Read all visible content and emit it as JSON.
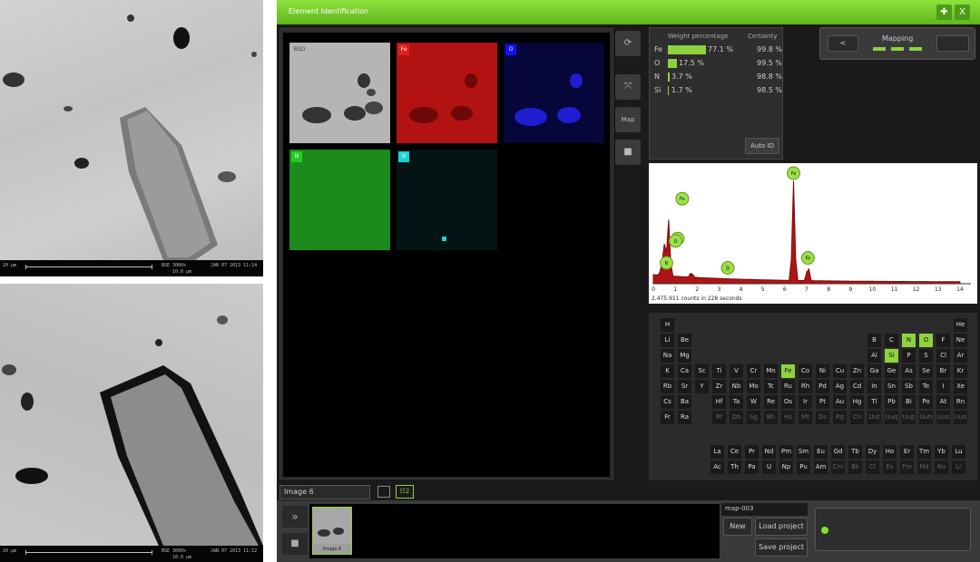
{
  "sem_images": [
    {
      "scale": "20 µm",
      "mag": "3000x",
      "date": "JAN 07 2013 11:14",
      "hfw": "10.0 µm",
      "det": "BSE"
    },
    {
      "scale": "20 µm",
      "mag": "3000x",
      "date": "JAN 07 2013 11:12",
      "hfw": "10.0 µm",
      "det": "BSE"
    }
  ],
  "window": {
    "title": "Element Identification",
    "pin_icon": "pin-icon",
    "close_label": "X"
  },
  "maps": [
    {
      "label": "BSD",
      "color": "#bbbbbb",
      "bg": "#a9a9a9"
    },
    {
      "label": "Fe",
      "color": "#e02020",
      "bg": "#a80f0f"
    },
    {
      "label": "O",
      "color": "#1010ff",
      "bg": "#060640"
    },
    {
      "label": "N",
      "color": "#20cc20",
      "bg": "#187f18"
    },
    {
      "label": "Si",
      "color": "#18d0d0",
      "bg": "#041616"
    }
  ],
  "side_tools": [
    {
      "icon": "refresh-icon",
      "glyph": "⟳"
    },
    {
      "icon": "expand-icon",
      "glyph": "⤧"
    },
    {
      "label": "Map"
    },
    {
      "icon": "stop-icon",
      "glyph": "■"
    }
  ],
  "weight": {
    "header_weight": "Weight percentage",
    "header_cert": "Certainty",
    "rows": [
      {
        "el": "Fe",
        "pct": "77.1 %",
        "cert": "99.8 %",
        "value": 77.1
      },
      {
        "el": "O",
        "pct": "17.5 %",
        "cert": "99.5 %",
        "value": 17.5
      },
      {
        "el": "N",
        "pct": "3.7 %",
        "cert": "98.8 %",
        "value": 3.7
      },
      {
        "el": "Si",
        "pct": "1.7 %",
        "cert": "98.5 %",
        "value": 1.7
      }
    ],
    "auto_id": "Auto ID"
  },
  "mapping": {
    "label": "Mapping",
    "prev": "<",
    "next": ""
  },
  "spectrum": {
    "counts": "2,475,911 counts in 228 seconds",
    "x_ticks": [
      "0",
      "1",
      "2",
      "3",
      "4",
      "5",
      "6",
      "7",
      "8",
      "9",
      "10",
      "11",
      "12",
      "13",
      "14"
    ],
    "peaks": [
      {
        "label": "Fe",
        "x": 6.4,
        "y": 1.0
      },
      {
        "label": "Fe",
        "x": 0.7,
        "y": 0.38
      },
      {
        "label": "Fe",
        "x": 0.7,
        "y": 0.18
      },
      {
        "label": "O",
        "x": 0.52,
        "y": 0.32
      },
      {
        "label": "N",
        "x": 0.39,
        "y": 0.1
      },
      {
        "label": "Si",
        "x": 1.74,
        "y": 0.05
      },
      {
        "label": "Fe",
        "x": 7.06,
        "y": 0.15
      }
    ]
  },
  "periodic": {
    "highlighted": [
      "N",
      "O",
      "Fe",
      "Si"
    ],
    "rows": [
      [
        "H",
        "",
        "",
        "",
        "",
        "",
        "",
        "",
        "",
        "",
        "",
        "",
        "",
        "",
        "",
        "",
        "",
        "He"
      ],
      [
        "Li",
        "Be",
        "",
        "",
        "",
        "",
        "",
        "",
        "",
        "",
        "",
        "",
        "B",
        "C",
        "N",
        "O",
        "F",
        "Ne"
      ],
      [
        "Na",
        "Mg",
        "",
        "",
        "",
        "",
        "",
        "",
        "",
        "",
        "",
        "",
        "Al",
        "Si",
        "P",
        "S",
        "Cl",
        "Ar"
      ],
      [
        "K",
        "Ca",
        "Sc",
        "Ti",
        "V",
        "Cr",
        "Mn",
        "Fe",
        "Co",
        "Ni",
        "Cu",
        "Zn",
        "Ga",
        "Ge",
        "As",
        "Se",
        "Br",
        "Kr"
      ],
      [
        "Rb",
        "Sr",
        "Y",
        "Zr",
        "Nb",
        "Mo",
        "Tc",
        "Ru",
        "Rh",
        "Pd",
        "Ag",
        "Cd",
        "In",
        "Sn",
        "Sb",
        "Te",
        "I",
        "Xe"
      ],
      [
        "Cs",
        "Ba",
        "",
        "Hf",
        "Ta",
        "W",
        "Re",
        "Os",
        "Ir",
        "Pt",
        "Au",
        "Hg",
        "Tl",
        "Pb",
        "Bi",
        "Po",
        "At",
        "Rn"
      ],
      [
        "Fr",
        "Ra",
        "",
        "Rf",
        "Db",
        "Sg",
        "Bh",
        "Hs",
        "Mt",
        "Ds",
        "Rg",
        "Cn",
        "Uut",
        "Uuq",
        "Uup",
        "Uuh",
        "Uus",
        "Uuo"
      ]
    ],
    "lanth": [
      "La",
      "Ce",
      "Pr",
      "Nd",
      "Pm",
      "Sm",
      "Eu",
      "Gd",
      "Tb",
      "Dy",
      "Ho",
      "Er",
      "Tm",
      "Yb",
      "Lu"
    ],
    "actin": [
      "Ac",
      "Th",
      "Pa",
      "U",
      "Np",
      "Pu",
      "Am",
      "Cm",
      "Bk",
      "Cf",
      "Es",
      "Fm",
      "Md",
      "No",
      "Lr"
    ]
  },
  "bottom": {
    "image_name": "Image 6",
    "thumb_label": "Image 6",
    "map_name": "map-003",
    "new": "New",
    "load": "Load project",
    "save": "Save project"
  }
}
